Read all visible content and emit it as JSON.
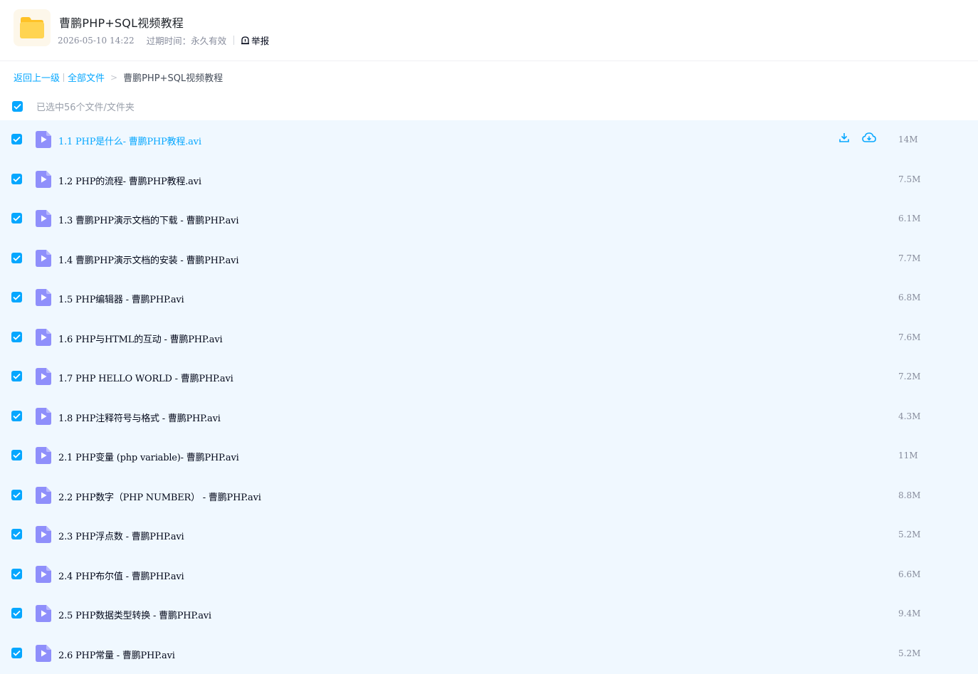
{
  "header": {
    "title": "曹鹏PHP+SQL视频教程",
    "date": "2026-05-10 14:22",
    "expire": "过期时间：永久有效",
    "report": "举报"
  },
  "breadcrumb": {
    "back": "返回上一级",
    "all_files": "全部文件",
    "current": "曹鹏PHP+SQL视频教程"
  },
  "selection": {
    "label": "已选中56个文件/文件夹"
  },
  "colors": {
    "accent": "#06a7ff",
    "row_bg": "#f0f8ff",
    "video_icon": "#8f8ffb"
  },
  "files": [
    {
      "name": "1.1 PHP是什么- 曹鹏PHP教程.avi",
      "size": "14M"
    },
    {
      "name": "1.2 PHP的流程- 曹鹏PHP教程.avi",
      "size": "7.5M"
    },
    {
      "name": "1.3 曹鹏PHP演示文档的下载 - 曹鹏PHP.avi",
      "size": "6.1M"
    },
    {
      "name": "1.4 曹鹏PHP演示文档的安装 - 曹鹏PHP.avi",
      "size": "7.7M"
    },
    {
      "name": "1.5 PHP编辑器 - 曹鹏PHP.avi",
      "size": "6.8M"
    },
    {
      "name": "1.6 PHP与HTML的互动 - 曹鹏PHP.avi",
      "size": "7.6M"
    },
    {
      "name": "1.7 PHP HELLO WORLD - 曹鹏PHP.avi",
      "size": "7.2M"
    },
    {
      "name": "1.8 PHP注释符号与格式 - 曹鹏PHP.avi",
      "size": "4.3M"
    },
    {
      "name": "2.1 PHP变量 (php variable)- 曹鹏PHP.avi",
      "size": "11M"
    },
    {
      "name": "2.2 PHP数字（PHP NUMBER） - 曹鹏PHP.avi",
      "size": "8.8M"
    },
    {
      "name": "2.3 PHP浮点数 - 曹鹏PHP.avi",
      "size": "5.2M"
    },
    {
      "name": "2.4 PHP布尔值 - 曹鹏PHP.avi",
      "size": "6.6M"
    },
    {
      "name": "2.5 PHP数据类型转换 - 曹鹏PHP.avi",
      "size": "9.4M"
    },
    {
      "name": "2.6 PHP常量 - 曹鹏PHP.avi",
      "size": "5.2M"
    }
  ],
  "row_actions": {
    "download_icon": "download-icon",
    "save_icon": "cloud-save-icon"
  }
}
